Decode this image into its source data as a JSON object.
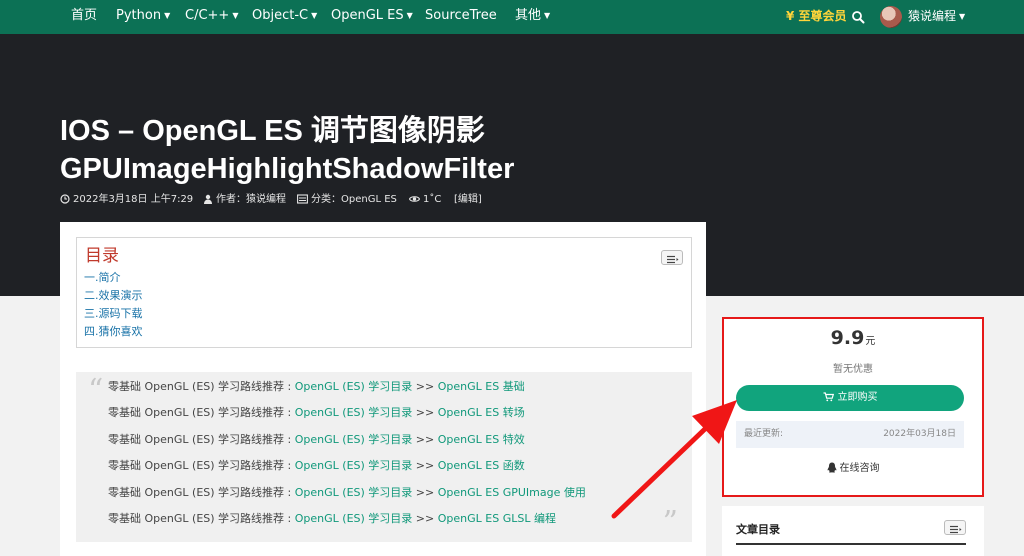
{
  "nav": {
    "items": [
      "首页",
      "Python",
      "C/C++",
      "Object-C",
      "OpenGL ES",
      "SourceTree",
      "其他"
    ],
    "vip": "¥ 至尊会员",
    "user": "猿说编程"
  },
  "article": {
    "title_line1": "IOS – OpenGL ES 调节图像阴影",
    "title_line2": "GPUImageHighlightShadowFilter",
    "meta": {
      "date": "2022年3月18日 上午7:29",
      "author": "作者：猿说编程",
      "category": "分类：OpenGL ES",
      "views": "1˚C",
      "edit": "[编辑]"
    },
    "toc": {
      "title": "目录",
      "items": [
        "一.简介",
        "二.效果演示",
        "三.源码下载",
        "四.猜你喜欢"
      ]
    },
    "quote": {
      "prefix": "零基础 OpenGL (ES) 学习路线推荐 : ",
      "path_link": "OpenGL (ES) 学习目录",
      "separator": " >> ",
      "topics": [
        "OpenGL ES 基础",
        "OpenGL ES 转场",
        "OpenGL ES 特效",
        "OpenGL ES 函数",
        "OpenGL ES GPUImage 使用",
        "OpenGL ES GLSL 编程"
      ]
    }
  },
  "sidebar": {
    "price": "9.9",
    "price_unit": "元",
    "discount": "暂无优惠",
    "buy_label": "立即购买",
    "update_label": "最近更新:",
    "update_date": "2022年03月18日",
    "consult_label": "在线咨询",
    "toc_title": "文章目录"
  },
  "colors": {
    "nav_bg": "#0c7155",
    "hero_bg": "#1f2125",
    "accent": "#11a47d",
    "link": "#10987a",
    "toc_link": "#1a73a8",
    "vip": "#ffd53a",
    "highlight": "#e61919"
  }
}
